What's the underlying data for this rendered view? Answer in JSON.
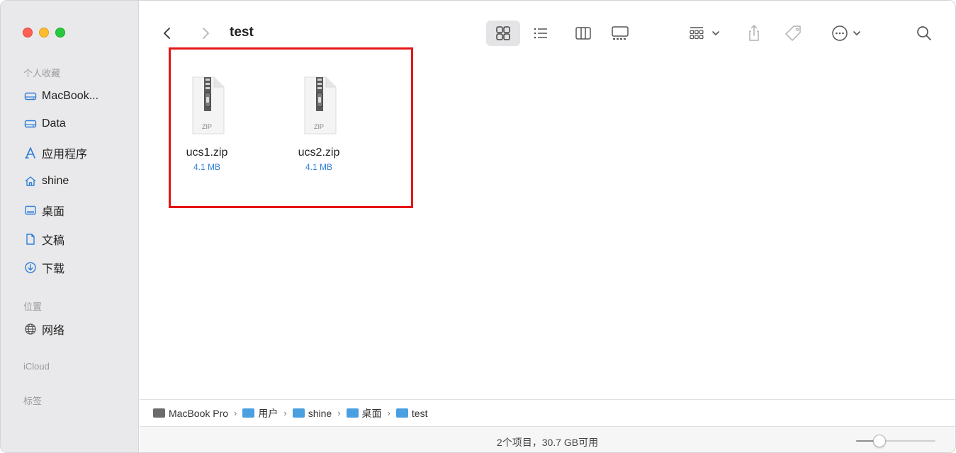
{
  "window": {
    "title": "test"
  },
  "sidebar": {
    "sections": [
      {
        "label": "个人收藏",
        "items": [
          {
            "label": "MacBook...",
            "icon": "disk-icon"
          },
          {
            "label": "Data",
            "icon": "disk-icon"
          },
          {
            "label": "应用程序",
            "icon": "applications-icon"
          },
          {
            "label": "shine",
            "icon": "home-icon"
          },
          {
            "label": "桌面",
            "icon": "desktop-icon"
          },
          {
            "label": "文稿",
            "icon": "document-icon"
          },
          {
            "label": "下载",
            "icon": "download-icon"
          }
        ]
      },
      {
        "label": "位置",
        "items": [
          {
            "label": "网络",
            "icon": "network-icon"
          }
        ]
      },
      {
        "label": "iCloud",
        "items": []
      },
      {
        "label": "标签",
        "items": []
      }
    ]
  },
  "toolbar": {
    "back_icon": "chevron-left-icon",
    "forward_icon": "chevron-right-icon",
    "views": [
      "icon-view-icon",
      "list-view-icon",
      "column-view-icon",
      "gallery-view-icon"
    ],
    "active_view": "icon-view-icon",
    "actions": [
      "group-icon",
      "share-icon",
      "tag-icon",
      "more-icon",
      "search-icon"
    ]
  },
  "files": [
    {
      "name": "ucs1.zip",
      "size": "4.1 MB",
      "type_label": "ZIP"
    },
    {
      "name": "ucs2.zip",
      "size": "4.1 MB",
      "type_label": "ZIP"
    }
  ],
  "pathbar": {
    "crumbs": [
      {
        "label": "MacBook Pro",
        "icon": "disk-icon"
      },
      {
        "label": "用户",
        "icon": "folder-icon"
      },
      {
        "label": "shine",
        "icon": "home-folder-icon"
      },
      {
        "label": "桌面",
        "icon": "folder-icon"
      },
      {
        "label": "test",
        "icon": "folder-icon"
      }
    ],
    "separator": "›"
  },
  "statusbar": {
    "text": "2个项目，30.7 GB可用",
    "zoom_level": 0.25
  },
  "colors": {
    "highlight": "#e61515",
    "file_size": "#2f7fd6",
    "folder": "#4a9fe0"
  }
}
